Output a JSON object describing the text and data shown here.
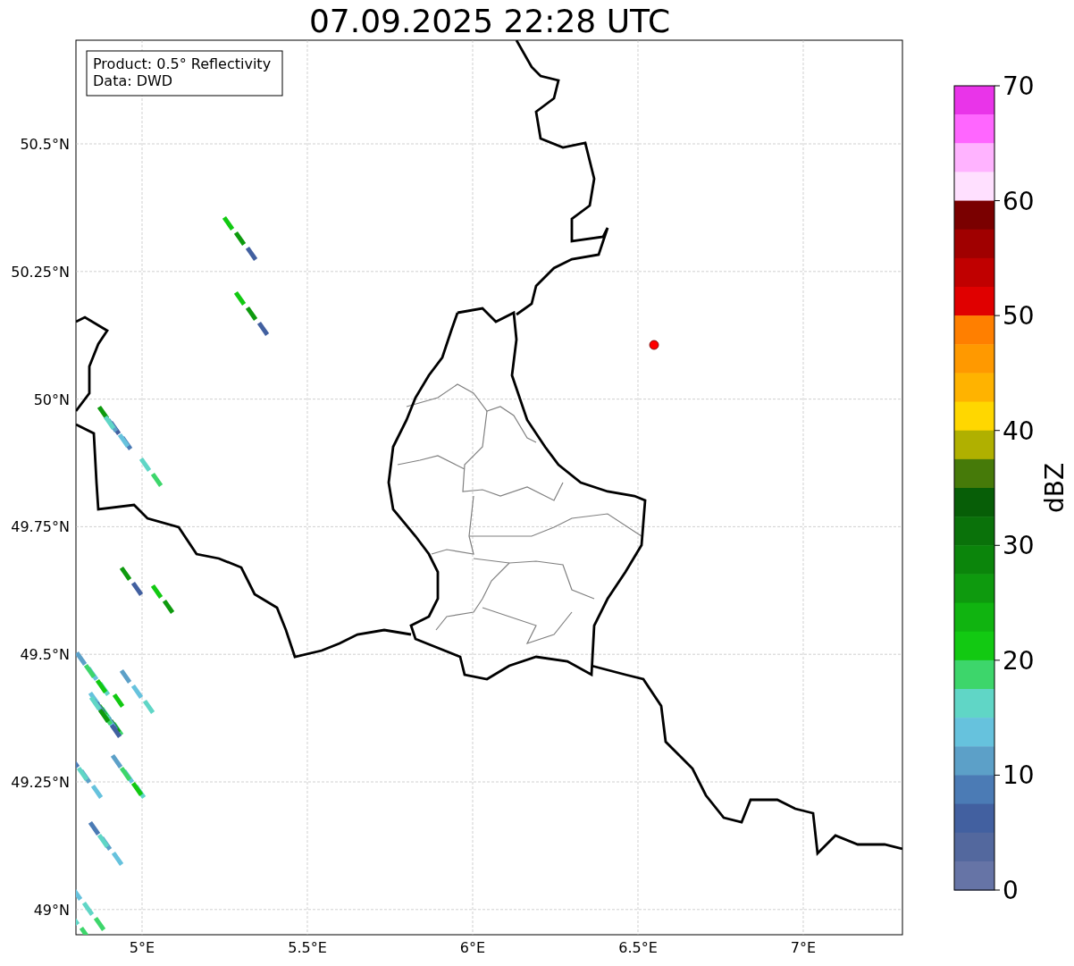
{
  "title": "07.09.2025 22:28 UTC",
  "legend": {
    "lines": [
      "Product: 0.5° Reflectivity",
      "Data: DWD"
    ]
  },
  "map": {
    "x_ticks": [
      "5°E",
      "5.5°E",
      "6°E",
      "6.5°E",
      "7°E"
    ],
    "y_ticks": [
      "50.5°N",
      "50.25°N",
      "50°N",
      "49.75°N",
      "49.5°N",
      "49.25°N",
      "49°N"
    ]
  },
  "colorbar": {
    "label": "dBZ",
    "ticks": [
      "70",
      "60",
      "50",
      "40",
      "30",
      "20",
      "10",
      "0"
    ],
    "bins": [
      {
        "color": "#e934e9"
      },
      {
        "color": "#ff66ff"
      },
      {
        "color": "#ffb3ff"
      },
      {
        "color": "#ffe0ff"
      },
      {
        "color": "#7a0000"
      },
      {
        "color": "#a00000"
      },
      {
        "color": "#c00000"
      },
      {
        "color": "#e00000"
      },
      {
        "color": "#ff7f00"
      },
      {
        "color": "#ff9900"
      },
      {
        "color": "#ffb300"
      },
      {
        "color": "#ffd700"
      },
      {
        "color": "#b0b000"
      },
      {
        "color": "#467a09"
      },
      {
        "color": "#075e07"
      },
      {
        "color": "#0a720a"
      },
      {
        "color": "#0b850b"
      },
      {
        "color": "#0e9a0e"
      },
      {
        "color": "#10b410"
      },
      {
        "color": "#12c912"
      },
      {
        "color": "#3dd66b"
      },
      {
        "color": "#60d6c6"
      },
      {
        "color": "#66c2dd"
      },
      {
        "color": "#5ca0c8"
      },
      {
        "color": "#4b7bb5"
      },
      {
        "color": "#4260a0"
      },
      {
        "color": "#53689e"
      },
      {
        "color": "#6674a6"
      }
    ]
  }
}
